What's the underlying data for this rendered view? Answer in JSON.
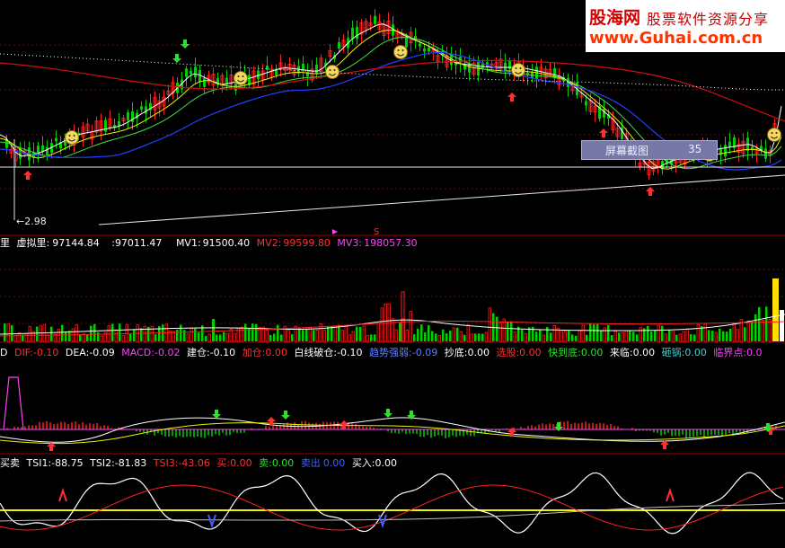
{
  "watermark": {
    "site_cn": "股海网",
    "slogan": "股票软件资源分享",
    "url": "www.Guhai.com.cn"
  },
  "screenshot_tip": {
    "label": "屏幕截图",
    "value": "35"
  },
  "price_panel": {
    "low_label": "2.98",
    "marker_s": "S"
  },
  "volume_header": {
    "prefix": "里",
    "virtual_label": "虚拟里:",
    "virtual_value": "97144.84",
    "v2_label": ":",
    "v2_value": "97011.47",
    "mv1_label": "MV1:",
    "mv1_value": "91500.40",
    "mv2_label": "MV2:",
    "mv2_value": "99599.80",
    "mv3_label": "MV3:",
    "mv3_value": "198057.30"
  },
  "macd_header": {
    "prefix": "D",
    "dif_label": "DIF:",
    "dif_value": "-0.10",
    "dea_label": "DEA:",
    "dea_value": "-0.09",
    "macd_label": "MACD:",
    "macd_value": "-0.02",
    "jc_label": "建仓:",
    "jc_value": "-0.10",
    "jia_label": "加仓:",
    "jia_value": "0.00",
    "bx_label": "白线破仓:",
    "bx_value": "-0.10",
    "qs_label": "趋势强弱:",
    "qs_value": "-0.09",
    "cd_label": "抄底:",
    "cd_value": "0.00",
    "xp_label": "选股:",
    "xp_value": "0.00",
    "kd_label": "快到底:",
    "kd_value": "0.00",
    "ll_label": "来临:",
    "ll_value": "0.00",
    "zq_label": "砸锅:",
    "zq_value": "0.00",
    "ljd_label": "临界点:",
    "ljd_value": "0.0"
  },
  "tsi_header": {
    "prefix": "买卖",
    "t1_label": "TSI1:",
    "t1_value": "-88.75",
    "t2_label": "TSI2:",
    "t2_value": "-81.83",
    "t3_label": "TSI3:",
    "t3_value": "-43.06",
    "buy_label": "买:",
    "buy_value": "0.00",
    "sell_label": "卖:",
    "sell_value": "0.00",
    "sellout_label": "卖出",
    "sellout_value": "0.00",
    "buyin_label": "买入:",
    "buyin_value": "0.00"
  },
  "colors": {
    "bg": "#000000",
    "up": "#ff2020",
    "down": "#00d000",
    "ma_white": "#ffffff",
    "ma_yellow": "#f0f000",
    "ma_green": "#40e040",
    "ma_blue": "#2040ff",
    "ma_red": "#d01010",
    "grid": "#a00000",
    "magenta": "#ff40ff",
    "cyan": "#40d0d0"
  },
  "chart_data": {
    "type": "candlestick",
    "low_price_marked": 2.98,
    "series": [
      {
        "name": "虚拟里",
        "values": [
          97144.84
        ]
      },
      {
        "name": "MV1",
        "values": [
          91500.4
        ]
      },
      {
        "name": "MV2",
        "values": [
          99599.8
        ]
      },
      {
        "name": "MV3",
        "values": [
          198057.3
        ]
      },
      {
        "name": "DIF",
        "values": [
          -0.1
        ]
      },
      {
        "name": "DEA",
        "values": [
          -0.09
        ]
      },
      {
        "name": "MACD",
        "values": [
          -0.02
        ]
      },
      {
        "name": "TSI1",
        "values": [
          -88.75
        ]
      },
      {
        "name": "TSI2",
        "values": [
          -81.83
        ]
      },
      {
        "name": "TSI3",
        "values": [
          -43.06
        ]
      }
    ]
  }
}
